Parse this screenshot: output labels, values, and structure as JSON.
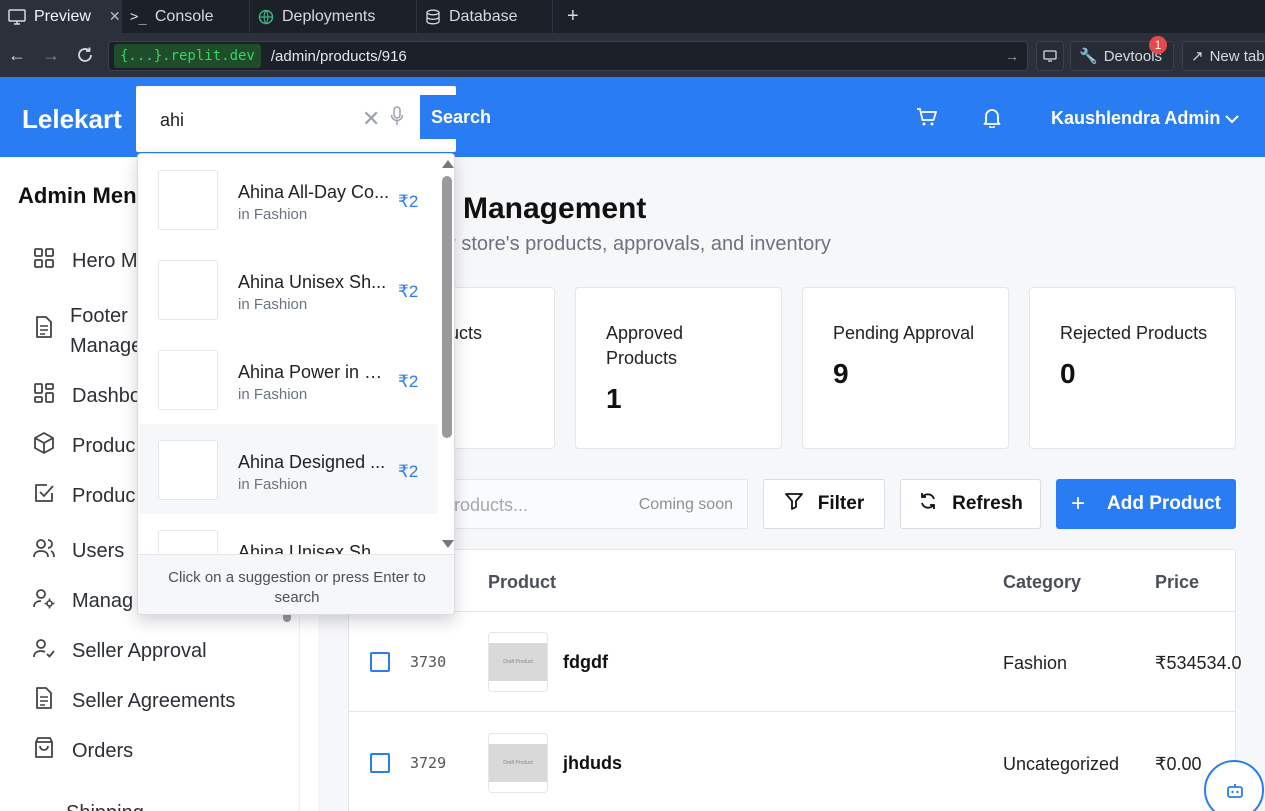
{
  "browser": {
    "tabs": [
      {
        "label": "Preview",
        "icon": "monitor-icon"
      },
      {
        "label": "Console",
        "icon": "terminal-icon"
      },
      {
        "label": "Deployments",
        "icon": "globe-icon"
      },
      {
        "label": "Database",
        "icon": "database-icon"
      }
    ],
    "url_host": "{...}.replit.dev",
    "url_path": "/admin/products/916",
    "devtools_label": "Devtools",
    "devtools_badge": "1",
    "newtab_label": "New tab"
  },
  "header": {
    "brand": "Lelekart",
    "search_value": "ahi",
    "search_button": "Search",
    "user_name": "Kaushlendra Admin"
  },
  "suggestions": {
    "items": [
      {
        "name": "Ahina All-Day Co...",
        "category": "in Fashion",
        "price": "₹2"
      },
      {
        "name": "Ahina Unisex Sh...",
        "category": "in Fashion",
        "price": "₹2"
      },
      {
        "name": "Ahina Power in E...",
        "category": "in Fashion",
        "price": "₹2"
      },
      {
        "name": "Ahina Designed ...",
        "category": "in Fashion",
        "price": "₹2"
      },
      {
        "name": "Ahina Unisex Sh...",
        "category": "",
        "price": ""
      }
    ],
    "footer": "Click on a suggestion or press Enter to search"
  },
  "sidebar": {
    "title": "Admin Men",
    "items": [
      {
        "label": "Hero M",
        "icon": "grid-icon"
      },
      {
        "label": "Footer\nManage",
        "icon": "document-icon"
      },
      {
        "label": "Dashbo",
        "icon": "grid-icon"
      },
      {
        "label": "Produc",
        "icon": "box-icon"
      },
      {
        "label": "Produc",
        "icon": "check-square-icon"
      },
      {
        "label": "Users",
        "icon": "users-icon"
      },
      {
        "label": "Manag",
        "icon": "user-gear-icon"
      },
      {
        "label": "Seller Approval",
        "icon": "user-check-icon"
      },
      {
        "label": "Seller Agreements",
        "icon": "document-icon"
      },
      {
        "label": "Orders",
        "icon": "shopping-bag-icon"
      },
      {
        "label": "Shipping",
        "icon": "truck-icon"
      }
    ]
  },
  "main": {
    "title": "Management",
    "subtitle": "ur store's products, approvals, and inventory",
    "cards": [
      {
        "label": "ucts",
        "value": ""
      },
      {
        "label": "Approved Products",
        "value": "1"
      },
      {
        "label": "Pending Approval",
        "value": "9"
      },
      {
        "label": "Rejected Products",
        "value": "0"
      }
    ],
    "search_placeholder": "roducts...",
    "search_hint": "Coming soon",
    "filter_label": "Filter",
    "refresh_label": "Refresh",
    "add_label": "Add Product",
    "table": {
      "headers": {
        "product": "Product",
        "category": "Category",
        "price": "Price"
      },
      "rows": [
        {
          "id": "3730",
          "thumb": "Draft Product",
          "name": "fdgdf",
          "category": "Fashion",
          "price": "₹534534.0"
        },
        {
          "id": "3729",
          "thumb": "Draft Product",
          "name": "jhduds",
          "category": "Uncategorized",
          "price": "₹0.00"
        }
      ]
    }
  },
  "colors": {
    "brand_blue": "#2a7cf2",
    "chrome_dark": "#1c2029",
    "host_green": "#38d16a"
  }
}
